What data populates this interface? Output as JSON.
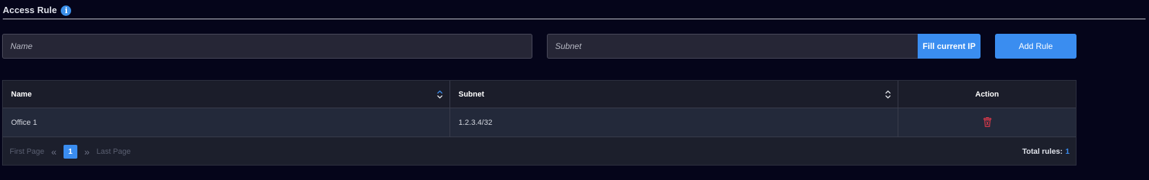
{
  "header": {
    "title": "Access Rule",
    "info_icon": "info-icon",
    "info_glyph": "i"
  },
  "form": {
    "name_placeholder": "Name",
    "subnet_placeholder": "Subnet",
    "fill_button": "Fill current IP",
    "add_button": "Add Rule"
  },
  "table": {
    "columns": [
      {
        "label": "Name",
        "sortable": true
      },
      {
        "label": "Subnet",
        "sortable": true
      },
      {
        "label": "Action",
        "sortable": false
      }
    ],
    "rows": [
      {
        "name": "Office 1",
        "subnet": "1.2.3.4/32",
        "action_icon": "trash-icon"
      }
    ]
  },
  "pagination": {
    "first_label": "First Page",
    "prev_icon": "double-chevron-left-icon",
    "current_page": "1",
    "next_icon": "double-chevron-right-icon",
    "last_label": "Last Page",
    "total_label": "Total rules:",
    "total_count": "1"
  },
  "colors": {
    "background": "#05051a",
    "accent": "#3a8df0",
    "delete": "#d9394a"
  }
}
